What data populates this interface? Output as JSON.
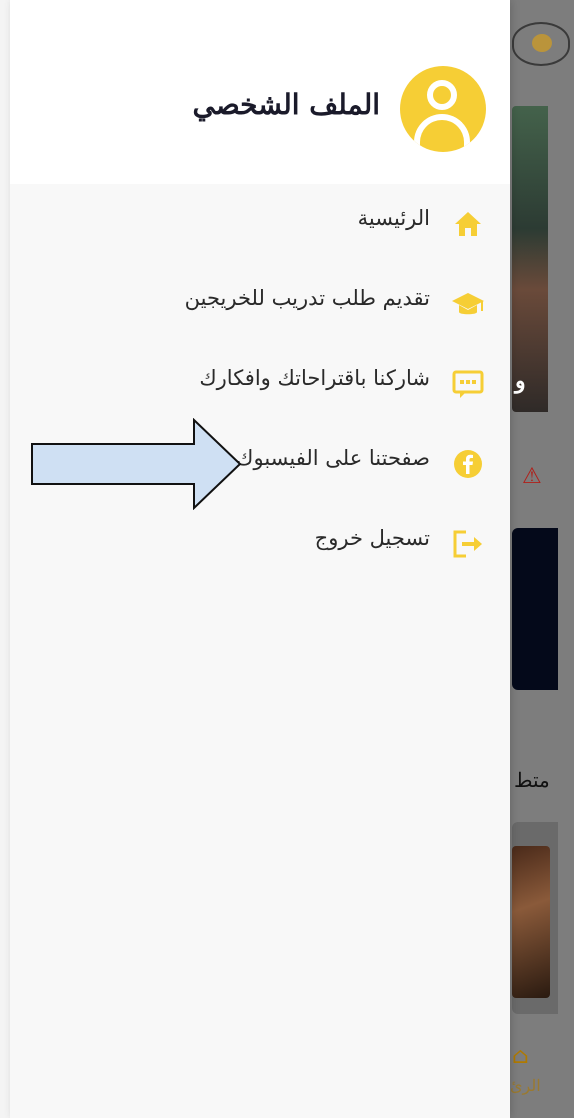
{
  "drawer": {
    "title": "الملف الشخصي",
    "items": [
      {
        "label": "الرئيسية",
        "icon": "home-icon"
      },
      {
        "label": "تقديم طلب تدريب للخريجين",
        "icon": "graduation-cap-icon"
      },
      {
        "label": "شاركنا باقتراحاتك وافكارك",
        "icon": "chat-icon"
      },
      {
        "label": "صفحتنا على الفيسبوك",
        "icon": "facebook-icon"
      },
      {
        "label": "تسجيل خروج",
        "icon": "logout-icon"
      }
    ]
  },
  "background": {
    "side_text_1": "و",
    "side_text_2": "متط",
    "nav_label": "الرئ"
  },
  "colors": {
    "accent": "#f6ce35",
    "drawer_bg": "#f8f8f8",
    "header_bg": "#ffffff",
    "arrow_fill": "#cfe0f3"
  }
}
